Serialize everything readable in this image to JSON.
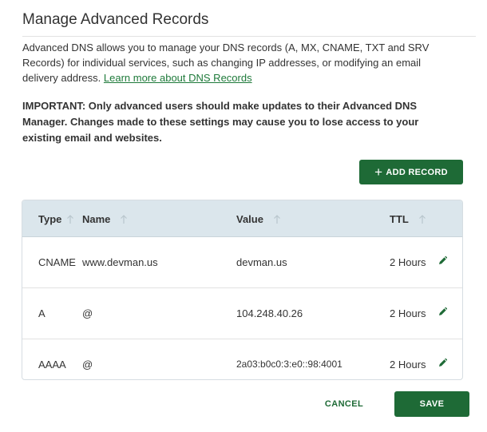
{
  "dialog": {
    "title": "Manage Advanced Records",
    "intro_text": "Advanced DNS allows you to manage your DNS records (A, MX, CNAME, TXT and SRV Records) for individual services, such as changing IP addresses, or modifying an email delivery address. ",
    "learn_more_link": "Learn more about DNS Records",
    "important_text": "IMPORTANT: Only advanced users should make updates to their Advanced DNS Manager. Changes made to these settings may cause you to lose access to your existing email and websites."
  },
  "add_record": {
    "icon": "plus-icon",
    "label": "ADD RECORD"
  },
  "table": {
    "columns": [
      {
        "label": "Type",
        "icon": "sort-up-arrow-icon"
      },
      {
        "label": "Name",
        "icon": "sort-up-arrow-icon"
      },
      {
        "label": "Value",
        "icon": "sort-up-arrow-icon"
      },
      {
        "label": "TTL",
        "icon": "sort-up-arrow-icon"
      }
    ],
    "rows": [
      {
        "type": "CNAME",
        "name": "www.devman.us",
        "value": "devman.us",
        "ttl": "2 Hours",
        "action_icon": "pencil-icon"
      },
      {
        "type": "A",
        "name": "@",
        "value": "104.248.40.26",
        "ttl": "2 Hours",
        "action_icon": "pencil-icon"
      },
      {
        "type": "AAAA",
        "name": "@",
        "value": "2a03:b0c0:3:e0::98:4001",
        "ttl": "2 Hours",
        "action_icon": "pencil-icon"
      }
    ]
  },
  "footer": {
    "cancel_label": "CANCEL",
    "save_label": "SAVE"
  },
  "colors": {
    "primary_green": "#1e6a36",
    "link_green": "#1e7a3a",
    "table_header_bg": "#dbe6ec"
  }
}
